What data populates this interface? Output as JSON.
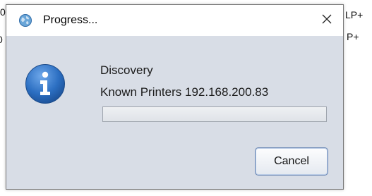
{
  "background": {
    "left_fragments": [
      "0",
      "0"
    ],
    "right_fragments": [
      "LP+",
      "P+"
    ]
  },
  "dialog": {
    "title": "Progress...",
    "app_icon": "globe-icon",
    "close_icon": "close-icon",
    "message_icon": "info-icon",
    "message_lines": [
      "Discovery",
      "Known Printers 192.168.200.83"
    ],
    "progress_fraction": 0,
    "cancel_label": "Cancel"
  },
  "colors": {
    "dialog_background": "#d8dde6",
    "titlebar_background": "#ffffff",
    "info_icon_blue": "#2c6fc2"
  }
}
